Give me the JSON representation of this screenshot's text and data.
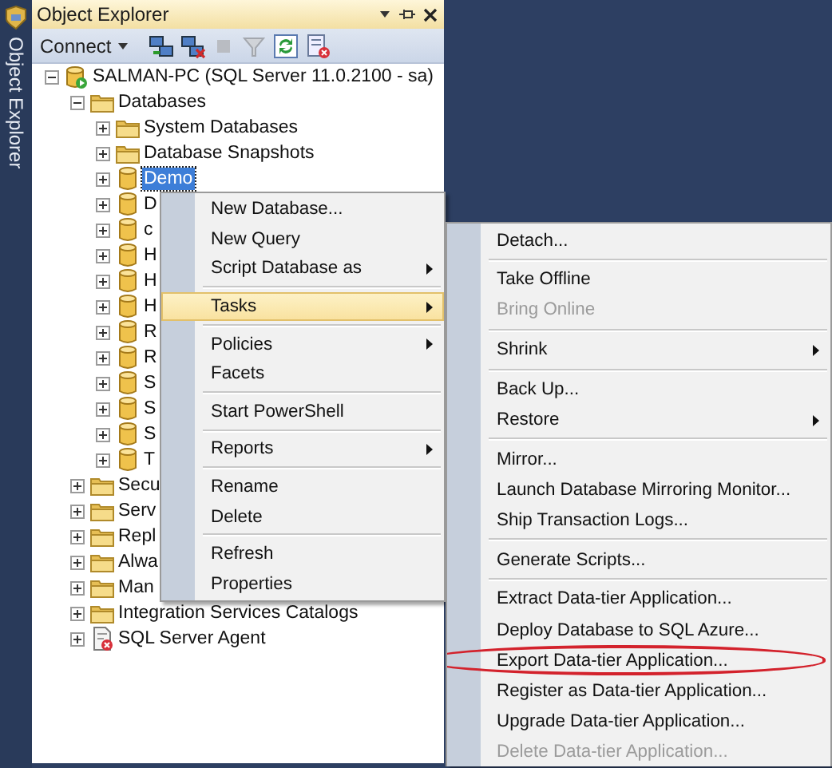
{
  "sidebar_tab": {
    "label": "Object Explorer"
  },
  "panel": {
    "title": "Object Explorer",
    "connect_label": "Connect"
  },
  "tree": [
    {
      "label": "SALMAN-PC (SQL Server 11.0.2100 - sa)",
      "kind": "server",
      "expanded": true,
      "selected": false,
      "children": [
        {
          "label": "Databases",
          "kind": "folder",
          "expanded": true,
          "selected": false,
          "children": [
            {
              "label": "System Databases",
              "kind": "folder",
              "expanded": false,
              "selected": false
            },
            {
              "label": "Database Snapshots",
              "kind": "folder",
              "expanded": false,
              "selected": false
            },
            {
              "label": "Demo",
              "kind": "database",
              "expanded": false,
              "selected": true
            },
            {
              "label": "D",
              "kind": "database",
              "expanded": false,
              "selected": false
            },
            {
              "label": "c",
              "kind": "database",
              "expanded": false,
              "selected": false
            },
            {
              "label": "H",
              "kind": "database",
              "expanded": false,
              "selected": false
            },
            {
              "label": "H",
              "kind": "database",
              "expanded": false,
              "selected": false
            },
            {
              "label": "H",
              "kind": "database",
              "expanded": false,
              "selected": false
            },
            {
              "label": "R",
              "kind": "database",
              "expanded": false,
              "selected": false
            },
            {
              "label": "R",
              "kind": "database",
              "expanded": false,
              "selected": false
            },
            {
              "label": "S",
              "kind": "database",
              "expanded": false,
              "selected": false
            },
            {
              "label": "S",
              "kind": "database",
              "expanded": false,
              "selected": false
            },
            {
              "label": "S",
              "kind": "database",
              "expanded": false,
              "selected": false
            },
            {
              "label": "T",
              "kind": "database",
              "expanded": false,
              "selected": false
            }
          ]
        },
        {
          "label": "Secu",
          "kind": "folder",
          "expanded": false,
          "selected": false
        },
        {
          "label": "Serv",
          "kind": "folder",
          "expanded": false,
          "selected": false
        },
        {
          "label": "Repl",
          "kind": "folder",
          "expanded": false,
          "selected": false
        },
        {
          "label": "Alwa",
          "kind": "folder",
          "expanded": false,
          "selected": false
        },
        {
          "label": "Man",
          "kind": "folder",
          "expanded": false,
          "selected": false
        },
        {
          "label": "Integration Services Catalogs",
          "kind": "folder",
          "expanded": false,
          "selected": false
        },
        {
          "label": "SQL Server Agent",
          "kind": "agent",
          "expanded": false,
          "selected": false
        }
      ]
    }
  ],
  "context_menu": {
    "items": [
      {
        "kind": "item",
        "label": "New Database...",
        "submenu": false,
        "selected": false
      },
      {
        "kind": "item",
        "label": "New Query",
        "submenu": false,
        "selected": false
      },
      {
        "kind": "item",
        "label": "Script Database as",
        "submenu": true,
        "selected": false
      },
      {
        "kind": "separator"
      },
      {
        "kind": "item",
        "label": "Tasks",
        "submenu": true,
        "selected": true
      },
      {
        "kind": "separator"
      },
      {
        "kind": "item",
        "label": "Policies",
        "submenu": true,
        "selected": false
      },
      {
        "kind": "item",
        "label": "Facets",
        "submenu": false,
        "selected": false
      },
      {
        "kind": "separator"
      },
      {
        "kind": "item",
        "label": "Start PowerShell",
        "submenu": false,
        "selected": false
      },
      {
        "kind": "separator"
      },
      {
        "kind": "item",
        "label": "Reports",
        "submenu": true,
        "selected": false
      },
      {
        "kind": "separator"
      },
      {
        "kind": "item",
        "label": "Rename",
        "submenu": false,
        "selected": false
      },
      {
        "kind": "item",
        "label": "Delete",
        "submenu": false,
        "selected": false
      },
      {
        "kind": "separator"
      },
      {
        "kind": "item",
        "label": "Refresh",
        "submenu": false,
        "selected": false
      },
      {
        "kind": "item",
        "label": "Properties",
        "submenu": false,
        "selected": false
      }
    ]
  },
  "tasks_submenu": {
    "items": [
      {
        "kind": "item",
        "label": "Detach...",
        "submenu": false,
        "disabled": false
      },
      {
        "kind": "separator"
      },
      {
        "kind": "item",
        "label": "Take Offline",
        "submenu": false,
        "disabled": false
      },
      {
        "kind": "item",
        "label": "Bring Online",
        "submenu": false,
        "disabled": true
      },
      {
        "kind": "separator"
      },
      {
        "kind": "item",
        "label": "Shrink",
        "submenu": true,
        "disabled": false
      },
      {
        "kind": "separator"
      },
      {
        "kind": "item",
        "label": "Back Up...",
        "submenu": false,
        "disabled": false
      },
      {
        "kind": "item",
        "label": "Restore",
        "submenu": true,
        "disabled": false
      },
      {
        "kind": "separator"
      },
      {
        "kind": "item",
        "label": "Mirror...",
        "submenu": false,
        "disabled": false
      },
      {
        "kind": "item",
        "label": "Launch Database Mirroring Monitor...",
        "submenu": false,
        "disabled": false
      },
      {
        "kind": "item",
        "label": "Ship Transaction Logs...",
        "submenu": false,
        "disabled": false
      },
      {
        "kind": "separator"
      },
      {
        "kind": "item",
        "label": "Generate Scripts...",
        "submenu": false,
        "disabled": false
      },
      {
        "kind": "separator"
      },
      {
        "kind": "item",
        "label": "Extract Data-tier Application...",
        "submenu": false,
        "disabled": false
      },
      {
        "kind": "item",
        "label": "Deploy Database to SQL Azure...",
        "submenu": false,
        "disabled": false
      },
      {
        "kind": "item",
        "label": "Export Data-tier Application...",
        "submenu": false,
        "disabled": false,
        "circled": true
      },
      {
        "kind": "item",
        "label": "Register as Data-tier Application...",
        "submenu": false,
        "disabled": false
      },
      {
        "kind": "item",
        "label": "Upgrade Data-tier Application...",
        "submenu": false,
        "disabled": false
      },
      {
        "kind": "item",
        "label": "Delete Data-tier Application...",
        "submenu": false,
        "disabled": true
      }
    ]
  }
}
